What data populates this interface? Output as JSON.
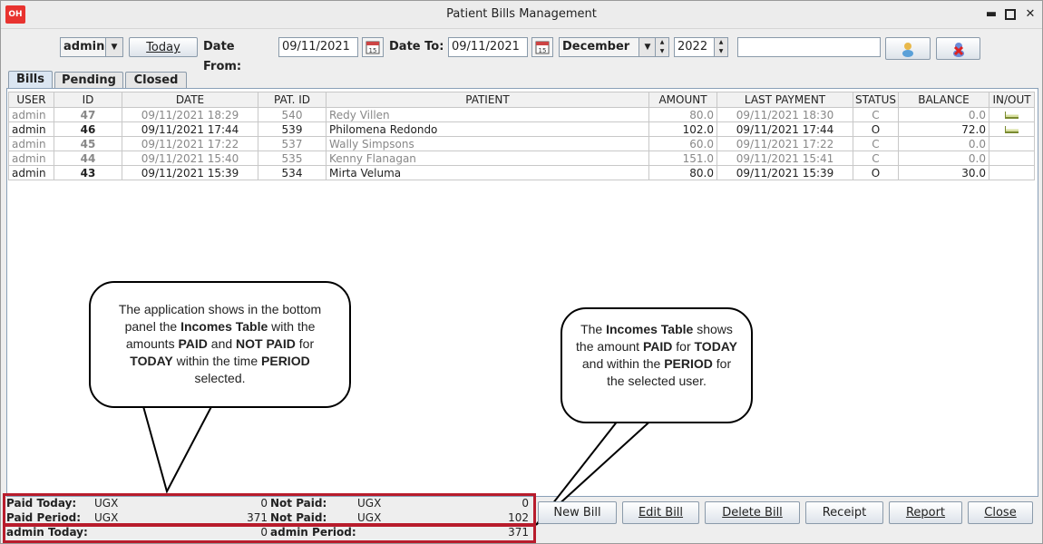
{
  "window": {
    "title": "Patient Bills Management",
    "app_icon": "OH"
  },
  "toolbar": {
    "user_combo": "admin",
    "today_button": "Today",
    "date_from_label": "Date From:",
    "date_from_value": "09/11/2021",
    "date_to_label": "Date To:",
    "date_to_value": "09/11/2021",
    "month": "December",
    "year": "2022",
    "search_value": ""
  },
  "tabs": [
    "Bills",
    "Pending",
    "Closed"
  ],
  "table": {
    "headers": [
      "USER",
      "ID",
      "DATE",
      "PAT. ID",
      "PATIENT",
      "AMOUNT",
      "LAST PAYMENT",
      "STATUS",
      "BALANCE",
      "IN/OUT"
    ],
    "rows": [
      {
        "user": "admin",
        "id": "47",
        "date": "09/11/2021 18:29",
        "pat_id": "540",
        "patient": "Redy Villen",
        "amount": "80.0",
        "last_payment": "09/11/2021 18:30",
        "status": "C",
        "balance": "0.0",
        "inout": true,
        "closed": true
      },
      {
        "user": "admin",
        "id": "46",
        "date": "09/11/2021 17:44",
        "pat_id": "539",
        "patient": "Philomena Redondo",
        "amount": "102.0",
        "last_payment": "09/11/2021 17:44",
        "status": "O",
        "balance": "72.0",
        "inout": true,
        "closed": false
      },
      {
        "user": "admin",
        "id": "45",
        "date": "09/11/2021 17:22",
        "pat_id": "537",
        "patient": "Wally Simpsons",
        "amount": "60.0",
        "last_payment": "09/11/2021 17:22",
        "status": "C",
        "balance": "0.0",
        "inout": false,
        "closed": true
      },
      {
        "user": "admin",
        "id": "44",
        "date": "09/11/2021 15:40",
        "pat_id": "535",
        "patient": "Kenny Flanagan",
        "amount": "151.0",
        "last_payment": "09/11/2021 15:41",
        "status": "C",
        "balance": "0.0",
        "inout": false,
        "closed": true
      },
      {
        "user": "admin",
        "id": "43",
        "date": "09/11/2021 15:39",
        "pat_id": "534",
        "patient": "Mirta Veluma",
        "amount": "80.0",
        "last_payment": "09/11/2021 15:39",
        "status": "O",
        "balance": "30.0",
        "inout": false,
        "closed": false
      }
    ]
  },
  "incomes": {
    "paid_today_label": "Paid Today:",
    "paid_today_currency": "UGX",
    "paid_today_value": "0",
    "not_paid_label": "Not Paid:",
    "not_paid_currency": "UGX",
    "not_paid_value": "0",
    "paid_period_label": "Paid Period:",
    "paid_period_currency": "UGX",
    "paid_period_value": "371",
    "not_paid_period_label": "Not Paid:",
    "not_paid_period_currency": "UGX",
    "not_paid_period_value": "102",
    "user_today_label": "admin Today:",
    "user_today_value": "0",
    "user_period_label": "admin Period:",
    "user_period_value": "371"
  },
  "buttons": {
    "new_bill": "New Bill",
    "edit_bill": "Edit Bill",
    "delete_bill": "Delete Bill",
    "receipt": "Receipt",
    "report": "Report",
    "close": "Close"
  },
  "callouts": {
    "left": {
      "p1": "The application shows in the bottom panel the ",
      "b1": "Incomes Table",
      "p2": " with the amounts ",
      "b2": "PAID",
      "p3": " and ",
      "b3": "NOT PAID",
      "p4": " for ",
      "b4": "TODAY",
      "p5": " within the time ",
      "b5": "PERIOD",
      "p6": " selected."
    },
    "right": {
      "p1": "The ",
      "b1": "Incomes Table",
      "p2": " shows the amount ",
      "b2": "PAID",
      "p3": " for ",
      "b3": "TODAY",
      "p4": " and within the ",
      "b4": "PERIOD",
      "p5": " for the selected user."
    }
  },
  "colors": {
    "highlight_box": "#b81c2c",
    "app_icon": "#e8332f"
  }
}
